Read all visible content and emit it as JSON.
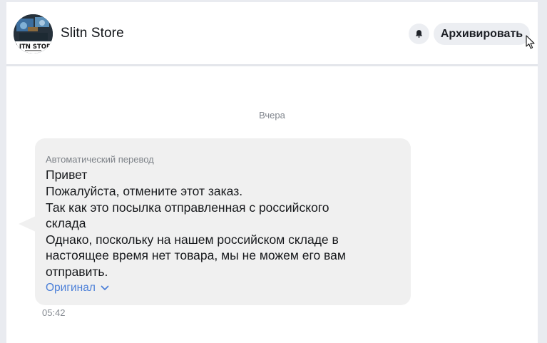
{
  "header": {
    "avatar_text": "LITN STOR",
    "store_name": "Slitn Store",
    "bell_icon": "bell-icon",
    "archive_label": "Архивировать"
  },
  "chat": {
    "date_separator": "Вчера",
    "message": {
      "translation_label": "Автоматический перевод",
      "lines": [
        "Привет",
        "Пожалуйста, отмените этот заказ.",
        "Так как это посылка отправленная с российского",
        "склада",
        "Однако, поскольку на нашем российском складе в",
        "настоящее время нет товара, мы не можем его вам",
        "отправить."
      ],
      "original_label": "Оригинал",
      "original_icon": "chevron-down-icon",
      "time": "05:42"
    }
  },
  "colors": {
    "bubble_bg": "#f0f0f0",
    "link": "#4b7fd8",
    "button_bg": "#eceef2",
    "page_bg": "#e9ebf0"
  }
}
